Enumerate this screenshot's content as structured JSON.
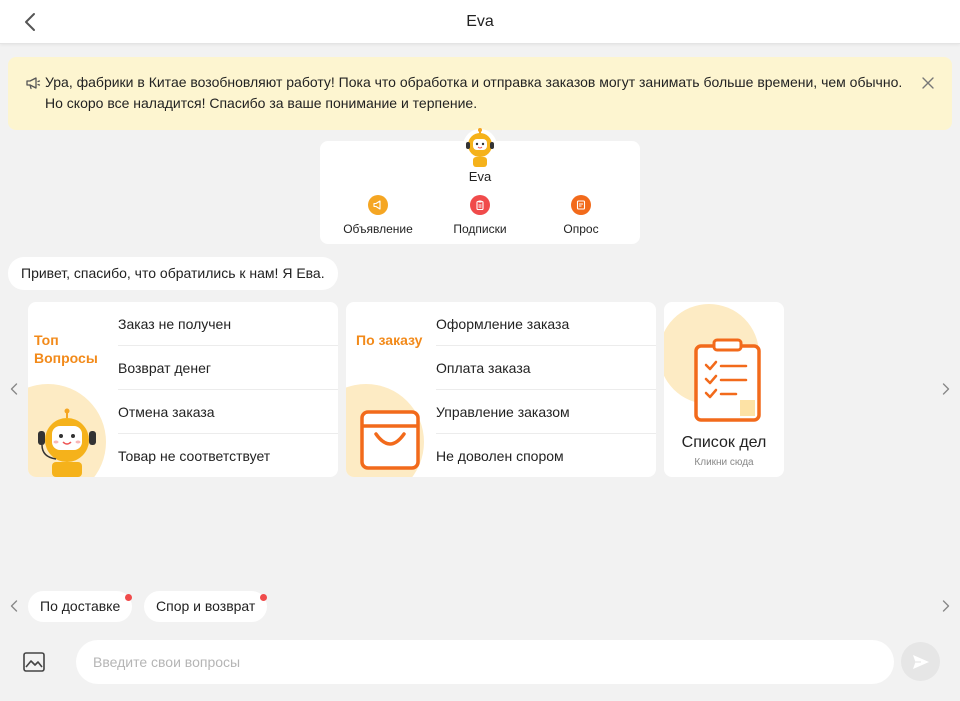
{
  "header": {
    "title": "Eva"
  },
  "notice": {
    "text": "Ура, фабрики в Китае возобновляют работу! Пока что обработка и отправка заказов могут занимать больше времени, чем обычно. Но скоро все наладится! Спасибо за ваше понимание и терпение.",
    "bg_color": "#fdf5d0"
  },
  "bot": {
    "name": "Eva",
    "actions": [
      {
        "label": "Объявление",
        "icon": "megaphone-icon",
        "color": "#f5a623"
      },
      {
        "label": "Подписки",
        "icon": "clipboard-icon",
        "color": "#f04b4b"
      },
      {
        "label": "Опрос",
        "icon": "survey-icon",
        "color": "#f26a1b"
      }
    ]
  },
  "greeting": "Привет, спасибо, что обратились к нам! Я Ева.",
  "cards": [
    {
      "title": "Топ Вопросы",
      "items": [
        "Заказ не получен",
        "Возврат денег",
        "Отмена заказа",
        "Товар не соответствует"
      ]
    },
    {
      "title": "По заказу",
      "items": [
        "Оформление заказа",
        "Оплата заказа",
        "Управление заказом",
        "Не доволен спором"
      ]
    }
  ],
  "todo": {
    "title": "Список дел",
    "subtitle": "Кликни сюда"
  },
  "chips": [
    "По доставке",
    "Спор и возврат"
  ],
  "input": {
    "placeholder": "Введите свои вопросы"
  },
  "colors": {
    "accent": "#f28a1a",
    "badge": "#f04b4b",
    "background": "#f2f2f2"
  }
}
